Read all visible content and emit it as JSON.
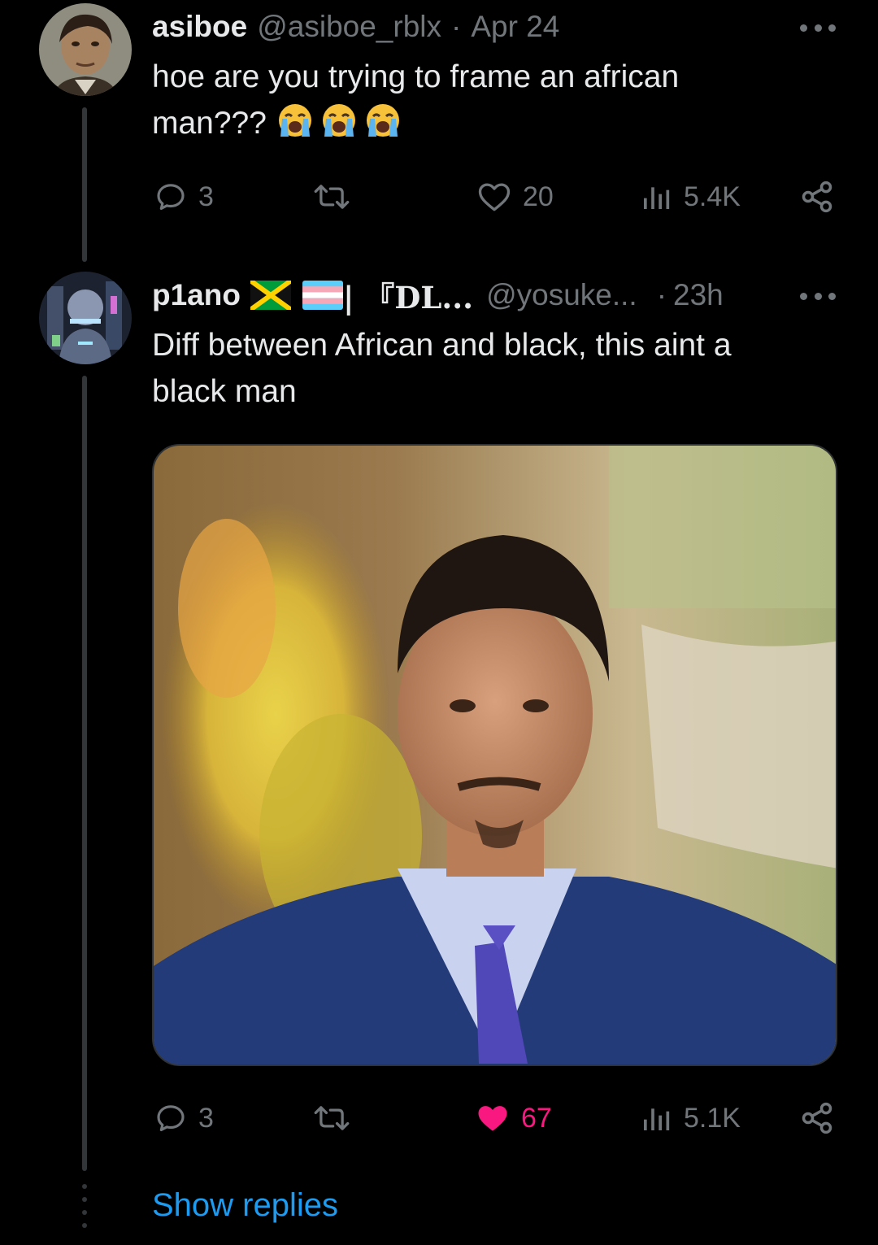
{
  "colors": {
    "background": "#000000",
    "text_primary": "#e7e9ea",
    "text_secondary": "#71767b",
    "link": "#1d9bf0",
    "liked": "#f91880",
    "thread_line": "#333639"
  },
  "tweets": [
    {
      "display_name": "asiboe",
      "handle": "@asiboe_rblx",
      "separator": "·",
      "timestamp": "Apr 24",
      "text_line1": "hoe are you trying to frame an african",
      "text_line2": "man???",
      "emojis": [
        "loudly-crying-face-icon",
        "loudly-crying-face-icon",
        "loudly-crying-face-icon"
      ],
      "reply_count": "3",
      "repost_count": "",
      "like_count": "20",
      "liked": false,
      "view_count": "5.4K"
    },
    {
      "display_name": "p1ano",
      "name_suffix": "| 『DL...",
      "flags": [
        "jamaica-flag-icon",
        "transgender-flag-icon"
      ],
      "handle": "@yosuke...",
      "separator": "·",
      "timestamp": "23h",
      "text_line1": "Diff between African and black, this aint a",
      "text_line2": "black man",
      "has_media": true,
      "reply_count": "3",
      "repost_count": "",
      "like_count": "67",
      "liked": true,
      "view_count": "5.1K"
    }
  ],
  "show_replies_label": "Show replies"
}
